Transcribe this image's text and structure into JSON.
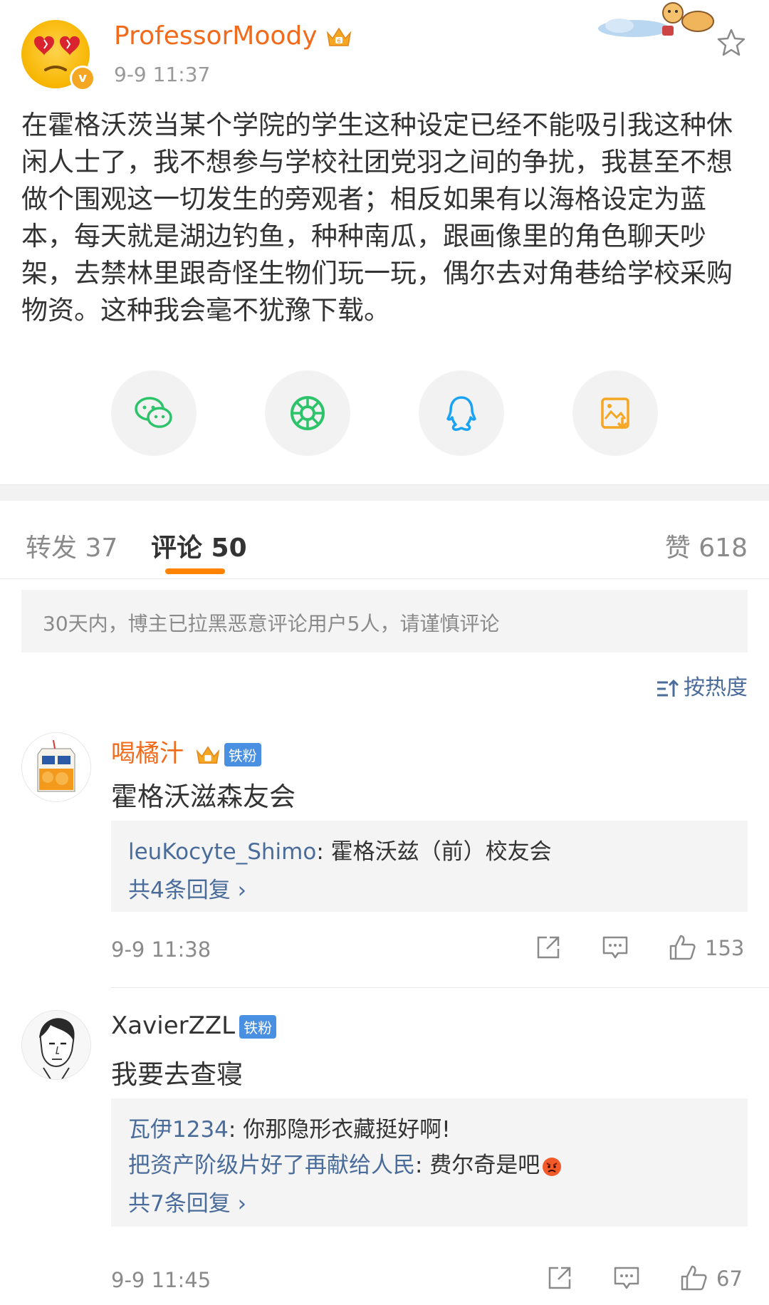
{
  "post": {
    "author": "ProfessorMoody",
    "time": "9-9 11:37",
    "verified_badge": "v",
    "text": "在霍格沃茨当某个学院的学生这种设定已经不能吸引我这种休闲人士了，我不想参与学校社团党羽之间的争扰，我甚至不想做个围观这一切发生的旁观者；相反如果有以海格设定为蓝本，每天就是湖边钓鱼，种种南瓜，跟画像里的角色聊天吵架，去禁林里跟奇怪生物们玩一玩，偶尔去对角巷给学校采购物资。这种我会毫不犹豫下载。"
  },
  "share": {
    "icons": [
      "wechat-icon",
      "moments-icon",
      "qq-icon",
      "save-image-icon"
    ]
  },
  "tabs": {
    "repost": "转发 37",
    "comments": "评论 50",
    "likes": "赞 618"
  },
  "notice": "30天内，博主已拉黑恶意评论用户5人，请谨慎评论",
  "sort_label": "按热度",
  "comments": [
    {
      "name": "喝橘汁",
      "badge": "铁粉",
      "text": "霍格沃滋森友会",
      "replies": [
        {
          "name": "leuKocyte_Shimo",
          "text": ": 霍格沃兹（前）校友会"
        }
      ],
      "more": "共4条回复 ›",
      "time": "9-9 11:38",
      "likes": "153"
    },
    {
      "name": "XavierZZL",
      "badge": "铁粉",
      "text": "我要去查寝",
      "replies": [
        {
          "name": "瓦伊1234",
          "text": ": 你那隐形衣藏挺好啊!"
        },
        {
          "name": "把资产阶级片好了再献给人民",
          "text": ": 费尔奇是吧"
        }
      ],
      "more": "共7条回复 ›",
      "time": "9-9 11:45",
      "likes": "67"
    }
  ],
  "colors": {
    "accent": "#ff8200",
    "link": "#4a6c9b",
    "username": "#f26b1d"
  }
}
